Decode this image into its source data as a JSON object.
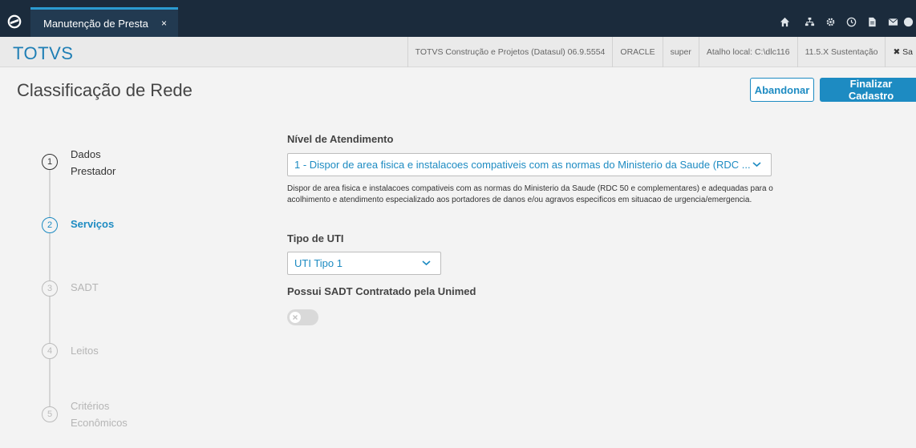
{
  "window": {
    "tab_label": "Manutenção de Presta",
    "tab_close": "×"
  },
  "topbar_icons": [
    "home-icon",
    "sitemap-icon",
    "gear-icon",
    "clock-icon",
    "document-icon",
    "mail-icon",
    "help-icon"
  ],
  "brandbar": {
    "brand": "TOTVS",
    "infos": [
      "TOTVS Construção e Projetos (Datasul) 06.9.5554",
      "ORACLE",
      "super",
      "Atalho local: C:\\dlc116",
      "11.5.X Sustentação"
    ],
    "exit_label": "✖ Sa"
  },
  "header": {
    "title": "Classificação de Rede",
    "abandon_label": "Abandonar",
    "finish_label": "Finalizar Cadastro"
  },
  "steps": [
    {
      "number": "1",
      "line1": "Dados",
      "line2": "Prestador",
      "state": "done"
    },
    {
      "number": "2",
      "line1": "Serviços",
      "line2": "",
      "state": "active"
    },
    {
      "number": "3",
      "line1": "SADT",
      "line2": "",
      "state": "pending"
    },
    {
      "number": "4",
      "line1": "Leitos",
      "line2": "",
      "state": "pending"
    },
    {
      "number": "5",
      "line1": "Critérios",
      "line2": "Econômicos",
      "state": "pending"
    }
  ],
  "form": {
    "nivel_label": "Nível de Atendimento",
    "nivel_value": "1 - Dispor de area fisica e instalacoes compativeis com as normas do Ministerio da Saude (RDC ...",
    "nivel_help": "Dispor de area fisica e instalacoes compativeis com as normas do Ministerio da Saude (RDC 50 e complementares) e adequadas para o acolhimento e atendimento especializado aos portadores de danos e/ou agravos especificos em situacao de urgencia/emergencia.",
    "uti_label": "Tipo de UTI",
    "uti_value": "UTI Tipo 1",
    "sadt_label": "Possui SADT Contratado pela Unimed",
    "sadt_toggle_on": false
  },
  "colors": {
    "topbar": "#1b2b3c",
    "accent": "#1d8bc2",
    "brand": "#1f7fb5"
  }
}
